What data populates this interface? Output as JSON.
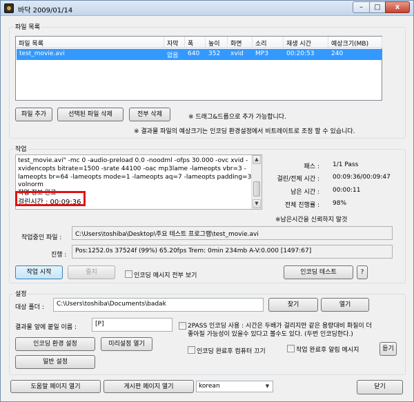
{
  "window": {
    "title": "바닥 2009/01/14",
    "min_label": "–",
    "max_label": "□",
    "close_label": "x"
  },
  "filelist": {
    "group_label": "파일 목록",
    "columns": [
      "파일 목록",
      "자막",
      "폭",
      "높이",
      "화면",
      "소리",
      "재생 시간",
      "예상크기(MB)"
    ],
    "rows": [
      [
        "test_movie.avi",
        "없음",
        "640",
        "352",
        "xvid",
        "MP3",
        "00:20:53",
        "240"
      ]
    ],
    "add_button": "파일 추가",
    "delete_selected_button": "선택된 파일 삭제",
    "delete_all_button": "전부 삭제",
    "hint_drag": "※ 드래그&드롭으로 추가 가능합니다.",
    "hint_size": "※ 결과물 파일의 예상크기는 인코딩 환경설정에서 비트레이트로 조정 할 수 있습니다."
  },
  "job": {
    "group_label": "작업",
    "log_lines": [
      "test_movie.avi\" -mc 0 -audio-preload 0.0 -noodml -ofps 30.000 -ovc xvid -",
      "xvidencopts bitrate=1500 -srate 44100 -oac mp3lame -lameopts vbr=3  -",
      "lameopts br=64 -lameopts mode=1 -lameopts aq=7 -lameopts padding=3 -af",
      "volnorm",
      "작업 정보 완료",
      "걸린시간 : 00:09:36"
    ],
    "pass_label": "패스 :",
    "pass_value": "1/1 Pass",
    "elapsed_label": "걸린/전체 시간 :",
    "elapsed_value": "00:09:36/00:09:47",
    "remaining_label": "남은 시간 :",
    "remaining_value": "00:00:11",
    "progress_label": "전체 진행률 :",
    "progress_value": "98%",
    "hint_remaining": "※남은시간을 신뢰하지 말것",
    "current_file_label": "작업중인 파일 :",
    "current_file_value": "C:\\Users\\toshiba\\Desktop\\주요 테스트 프로그램\\test_movie.avi",
    "status_label": "진행 :",
    "status_value": "Pos:1252.0s  37524f (99%) 65.20fps Trem:   0min 234mb  A-V:0.000 [1497:67]",
    "start_button": "작업 시작",
    "stop_button": "중지",
    "show_all_messages": "인코딩 메시지 전부 보기",
    "encode_test_button": "인코딩 테스트",
    "help_button": "?"
  },
  "settings": {
    "group_label": "설정",
    "target_folder_label": "대상 폴더 :",
    "target_folder_value": "C:\\Users\\toshiba\\Documents\\badak",
    "browse_button": "찾기",
    "open_button": "열기",
    "prefix_label": "결과물 앞에 붙일 이름 :",
    "prefix_value": "[P]",
    "twopass_line1": "2PASS 인코딩 사용 : 시간은 두배가 걸리지만 같은 용량대비 화질이 더",
    "twopass_line2": "좋아질 가능성이 있을수 있다고 볼수도 있다. (두번 인코딩한다.)",
    "encode_settings_button": "인코딩 환경 설정",
    "preset_button": "미리설정 열기",
    "shutdown_label": "인코딩 완료후 컴퓨터 끄기",
    "notify_label": "작업 완료후 알림 메시지",
    "listen_button": "듣기",
    "general_settings_button": "일반 설정"
  },
  "footer": {
    "help_button": "도움말 페이지 열기",
    "forum_button": "게시판 페이지 열기",
    "language_value": "korean",
    "close_button": "닫기"
  }
}
